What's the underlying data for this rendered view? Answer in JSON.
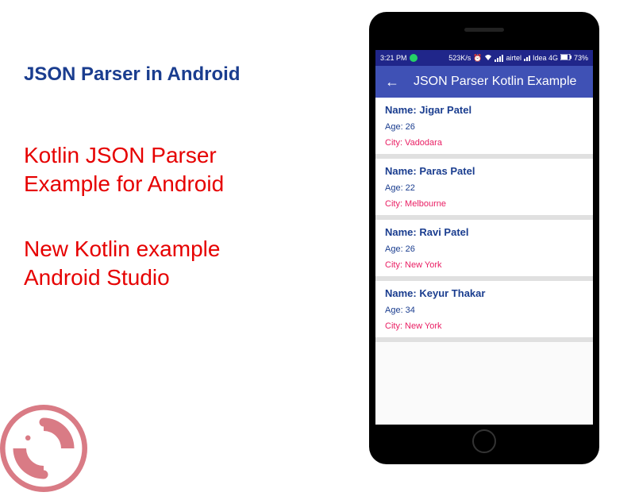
{
  "left": {
    "title": "JSON Parser in Android",
    "heading1_line1": "Kotlin JSON Parser",
    "heading1_line2": " Example for Android",
    "heading2_line1": "New Kotlin example",
    "heading2_line2": " Android Studio"
  },
  "status_bar": {
    "time": "3:21 PM",
    "speed": "523K/s",
    "carrier1": "airtel",
    "carrier2": "Idea 4G",
    "battery": "73%"
  },
  "app_bar": {
    "title": "JSON Parser Kotlin Example"
  },
  "list": [
    {
      "name_label": "Name:",
      "name": "Jigar Patel",
      "age_label": "Age:",
      "age": "26",
      "city_label": "City:",
      "city": "Vadodara"
    },
    {
      "name_label": "Name:",
      "name": "Paras Patel",
      "age_label": "Age:",
      "age": "22",
      "city_label": "City:",
      "city": "Melbourne"
    },
    {
      "name_label": "Name:",
      "name": "Ravi Patel",
      "age_label": "Age:",
      "age": "26",
      "city_label": "City:",
      "city": "New York"
    },
    {
      "name_label": "Name:",
      "name": "Keyur Thakar",
      "age_label": "Age:",
      "age": "34",
      "city_label": "City:",
      "city": "New York"
    }
  ]
}
